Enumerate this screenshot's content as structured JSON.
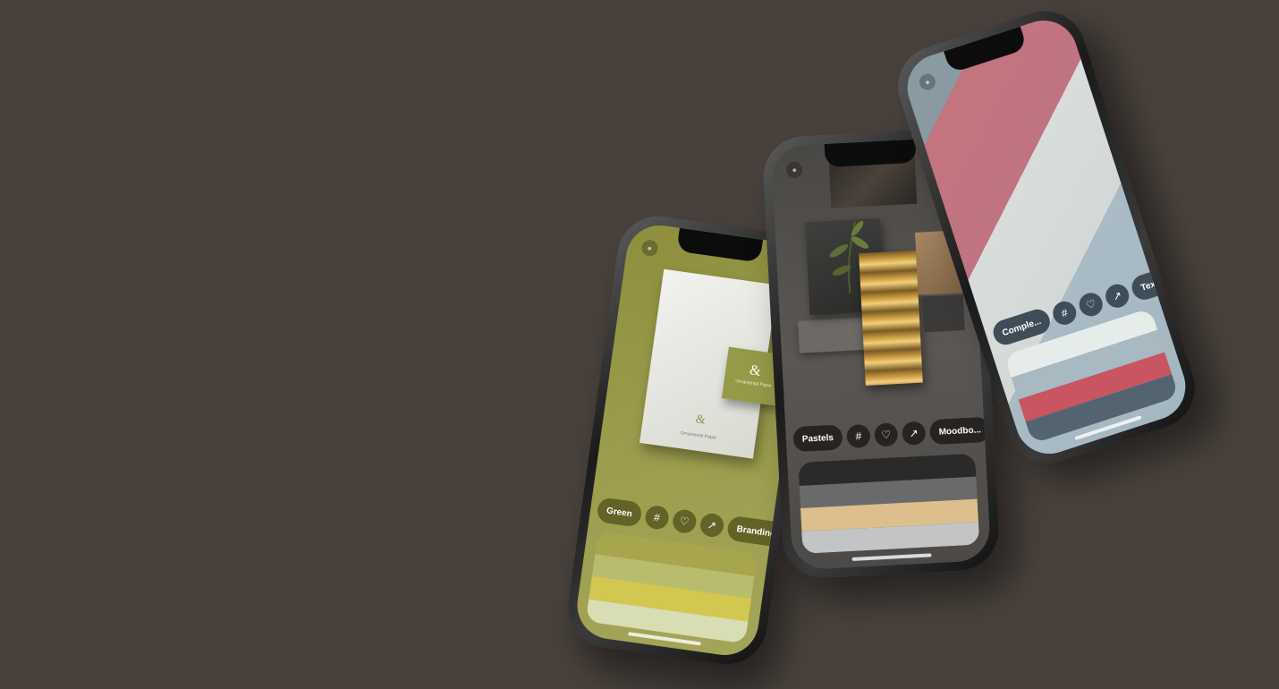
{
  "phones": [
    {
      "id": "green",
      "toolbar": {
        "tag_label": "Green",
        "hash_icon": "#",
        "heart_icon": "♡",
        "share_icon": "↗",
        "category_label": "Branding"
      },
      "mockup": {
        "ampersand": "&",
        "card_caption": "Ornamental Paper",
        "small_caption": "Ornamental Paper"
      },
      "palette": [
        "#a7a54d",
        "#b9bc6d",
        "#d2c851",
        "#d8ddb3"
      ]
    },
    {
      "id": "dark",
      "toolbar": {
        "tag_label": "Pastels",
        "hash_icon": "#",
        "heart_icon": "♡",
        "share_icon": "↗",
        "category_label": "Moodbo..."
      },
      "palette": [
        "#2a2a2a",
        "#6a6a6a",
        "#dcbf8c",
        "#c3c4c6"
      ]
    },
    {
      "id": "textiles",
      "toolbar": {
        "tag_label": "Comple...",
        "hash_icon": "#",
        "heart_icon": "♡",
        "share_icon": "↗",
        "category_label": "Textiles"
      },
      "palette": [
        "#e6ecea",
        "#a8b9c2",
        "#c95562",
        "#536470"
      ]
    }
  ]
}
